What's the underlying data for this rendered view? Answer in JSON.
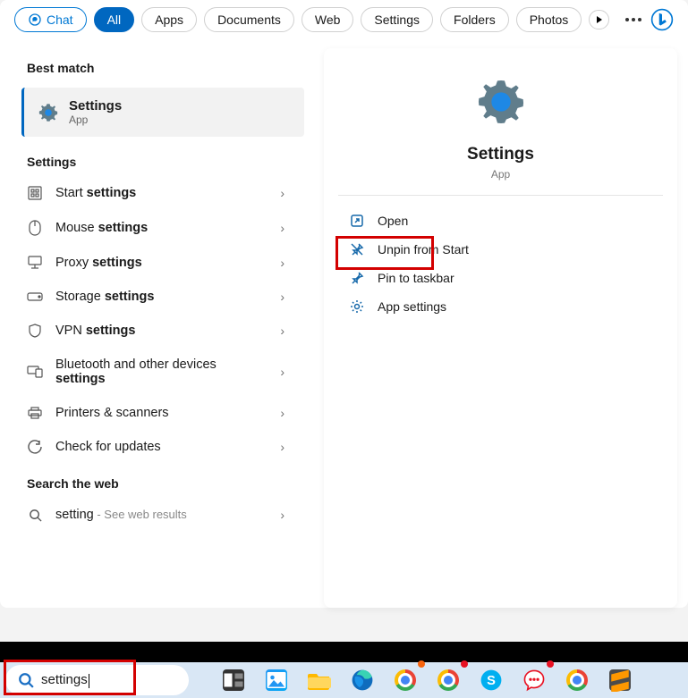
{
  "filters": {
    "chat": "Chat",
    "all": "All",
    "apps": "Apps",
    "documents": "Documents",
    "web": "Web",
    "settings": "Settings",
    "folders": "Folders",
    "photos": "Photos"
  },
  "left": {
    "best_match_header": "Best match",
    "best_match": {
      "title": "Settings",
      "subtitle": "App"
    },
    "settings_header": "Settings",
    "items": [
      {
        "pre": "Start ",
        "bold": "settings"
      },
      {
        "pre": "Mouse ",
        "bold": "settings"
      },
      {
        "pre": "Proxy ",
        "bold": "settings"
      },
      {
        "pre": "Storage ",
        "bold": "settings"
      },
      {
        "pre": "VPN ",
        "bold": "settings"
      },
      {
        "pre": "Bluetooth and other devices ",
        "bold": "settings"
      },
      {
        "pre": "Printers & scanners",
        "bold": ""
      },
      {
        "pre": "Check for updates",
        "bold": ""
      }
    ],
    "web_header": "Search the web",
    "web_item": {
      "query": "setting",
      "tail": " - See web results"
    }
  },
  "preview": {
    "title": "Settings",
    "subtitle": "App",
    "actions": {
      "open": "Open",
      "unpin": "Unpin from Start",
      "pin_taskbar": "Pin to taskbar",
      "app_settings": "App settings"
    }
  },
  "search": {
    "value": "settings"
  }
}
